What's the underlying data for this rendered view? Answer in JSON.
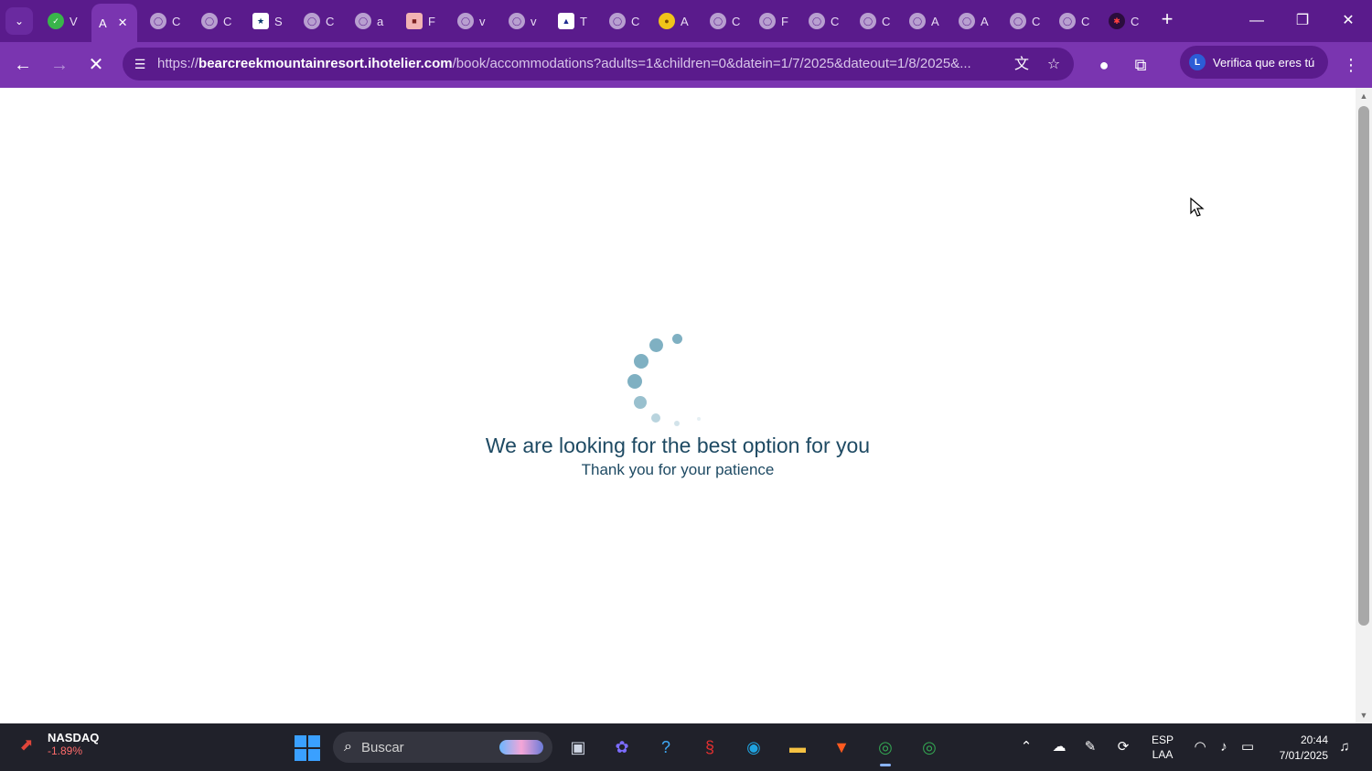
{
  "browser": {
    "tabs": [
      {
        "icon": "green-circle-favicon",
        "letter": "V"
      },
      {
        "icon": "globe-favicon",
        "letter": "C"
      },
      {
        "icon": "globe-favicon",
        "letter": "C"
      },
      {
        "icon": "nfl-favicon",
        "letter": "S"
      },
      {
        "icon": "globe-favicon",
        "letter": "C"
      },
      {
        "icon": "globe-favicon",
        "letter": "a"
      },
      {
        "icon": "gift-favicon",
        "letter": "F"
      },
      {
        "icon": "globe-favicon",
        "letter": "v"
      },
      {
        "icon": "globe-favicon",
        "letter": "v"
      },
      {
        "icon": "flag-favicon",
        "letter": "T"
      },
      {
        "icon": "globe-favicon",
        "letter": "C"
      },
      {
        "icon": "ball-favicon",
        "letter": "A"
      },
      {
        "icon": "globe-favicon",
        "letter": "C"
      },
      {
        "icon": "globe-favicon",
        "letter": "F"
      },
      {
        "icon": "globe-favicon",
        "letter": "C"
      },
      {
        "icon": "globe-favicon",
        "letter": "C"
      },
      {
        "icon": "globe-favicon",
        "letter": "A"
      },
      {
        "icon": "globe-favicon",
        "letter": "A"
      },
      {
        "icon": "globe-favicon",
        "letter": "C"
      },
      {
        "icon": "globe-favicon",
        "letter": "C"
      },
      {
        "icon": "bug-favicon",
        "letter": "C"
      }
    ],
    "active_tab": {
      "letter": "A",
      "close": "✕"
    },
    "new_tab": "+",
    "url_prefix": "https://",
    "url_domain": "bearcreekmountainresort.ihotelier.com",
    "url_path": "/book/accommodations?adults=1&children=0&datein=1/7/2025&dateout=1/8/2025&...",
    "profile_initial": "L",
    "profile_label": "Verifica que eres tú",
    "theme": {
      "frame": "#5a1b8c",
      "toolbar": "#7a35b0"
    }
  },
  "page": {
    "loading_title": "We are looking for the best option for you",
    "loading_subtitle": "Thank you for your patience",
    "spinner_color": "#7fb0c2"
  },
  "taskbar": {
    "widget_name": "NASDAQ",
    "widget_value": "-1.89%",
    "search_placeholder": "Buscar",
    "lang_line1": "ESP",
    "lang_line2": "LAA",
    "time": "20:44",
    "date": "7/01/2025"
  }
}
